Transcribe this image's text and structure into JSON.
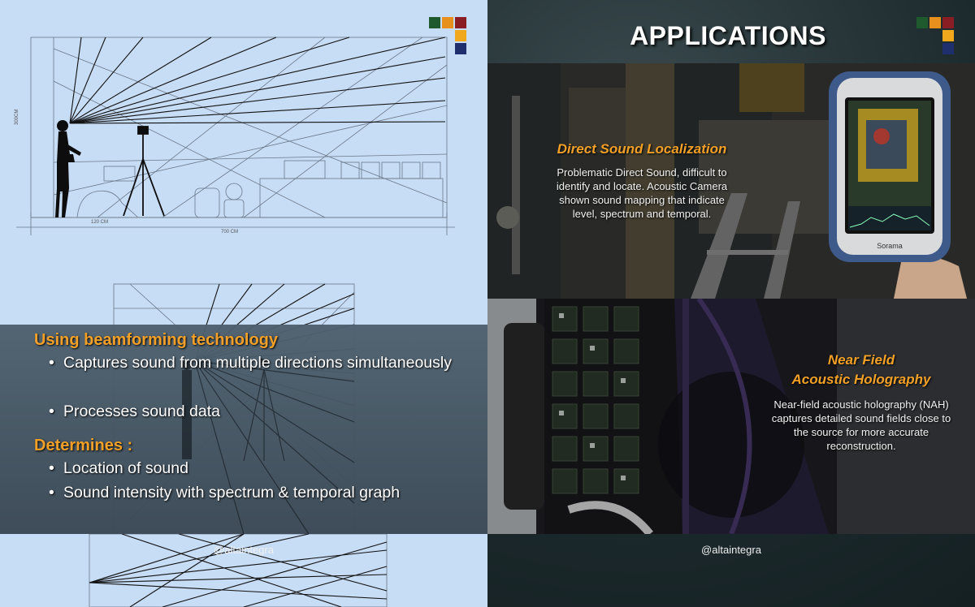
{
  "left_panel": {
    "heading_1": "Using beamforming technology",
    "bullets_1": [
      {
        "symbol": "•",
        "text": "Captures sound from multiple directions simultaneously"
      },
      {
        "symbol": "•",
        "text": "Processes sound data"
      }
    ],
    "heading_2": "Determines :",
    "bullets_2": [
      {
        "symbol": "•",
        "text": "Location of sound"
      },
      {
        "symbol": "•",
        "text": "Sound intensity with spectrum & temporal graph"
      }
    ],
    "sketch_labels": {
      "height": "300CM",
      "distance_1": "120 CM",
      "distance_2": "700 CM"
    },
    "handle": "@altaintegra"
  },
  "right_panel": {
    "title": "APPLICATIONS",
    "card_1": {
      "heading": "Direct Sound Localization",
      "body_lines": [
        "Problematic Direct Sound, difficult to",
        "identify and locate. Acoustic Camera",
        "shown sound mapping that indicate",
        "level, spectrum and temporal."
      ],
      "device_brand": "Sorama"
    },
    "card_2": {
      "heading_line_1": "Near Field",
      "heading_line_2": "Acoustic Holography",
      "body_lines": [
        "Near-field acoustic holography (NAH)",
        "captures detailed sound fields close to",
        "the source for more accurate",
        "reconstruction."
      ]
    },
    "handle": "@altaintegra"
  },
  "logo_colors": [
    "#1f5a2e",
    "#e8901e",
    "#8a1c24",
    "#f2a81c",
    "#1f2f6e"
  ],
  "accent_color": "#f2a027"
}
